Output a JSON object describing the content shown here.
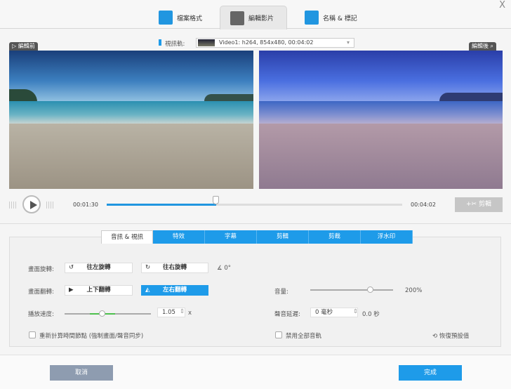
{
  "top_tabs": [
    {
      "label": "檔案格式"
    },
    {
      "label": "編輯影片"
    },
    {
      "label": "名稱 & 標記"
    }
  ],
  "close_label": "X",
  "track_label": "視訊軌:",
  "track_value": "Video1: h264, 854x480, 00:04:02",
  "before_label": "編輯前",
  "after_label": "編輯後",
  "player": {
    "current": "00:01:30",
    "total": "00:04:02",
    "progress_percent": 37,
    "cut_label": "剪輯"
  },
  "sub_tabs": [
    {
      "label": "音訊 & 視訊"
    },
    {
      "label": "特效"
    },
    {
      "label": "字幕"
    },
    {
      "label": "剪輯"
    },
    {
      "label": "剪裁"
    },
    {
      "label": "浮水印"
    }
  ],
  "settings": {
    "rotate_label": "畫面旋轉:",
    "rotate_left": "往左旋轉",
    "rotate_right": "往右旋轉",
    "angle": "0°",
    "flip_label": "畫面翻轉:",
    "flip_vertical": "上下翻轉",
    "flip_horizontal": "左右翻轉",
    "speed_label": "播放速度:",
    "speed_value": "1.05",
    "speed_unit": "x",
    "volume_label": "音量:",
    "volume_value": "200%",
    "delay_label": "聲音延遲:",
    "delay_value": "0 毫秒",
    "delay_seconds": "0.0 秒",
    "recalc_label": "重新計算時間節點 (強制畫面/聲音同步)",
    "disable_audio_label": "禁用全部音軌",
    "reset_label": "恢復預設值"
  },
  "footer": {
    "cancel": "取消",
    "done": "完成"
  },
  "colors": {
    "accent": "#1e9be9",
    "cancel": "#8e9cb0"
  }
}
